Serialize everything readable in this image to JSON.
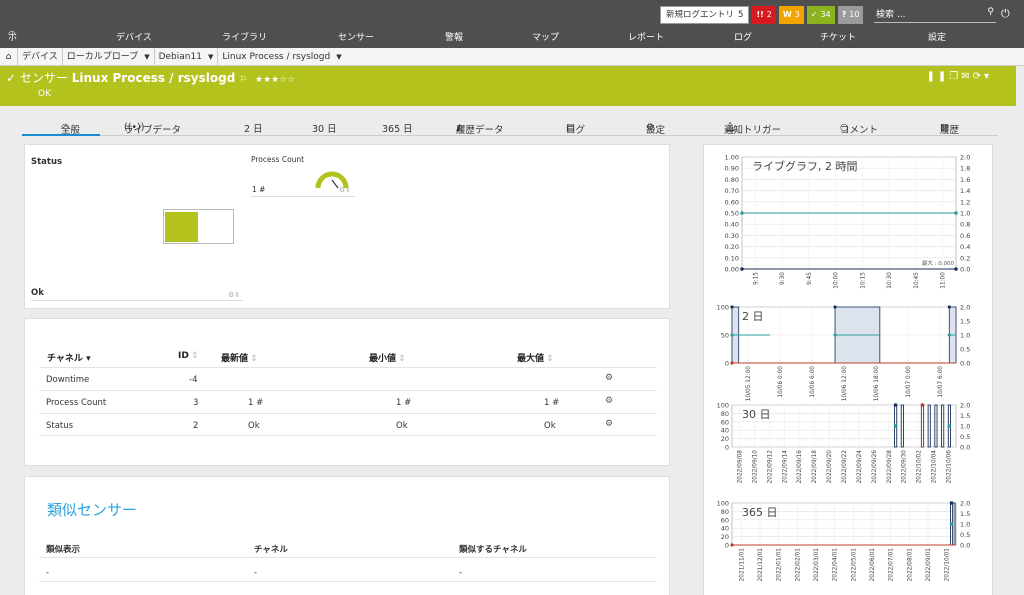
{
  "topbar": {
    "newlog_label": "新規ログエントリ",
    "newlog_count": "5",
    "alarms": [
      {
        "icon": "!!",
        "count": "2",
        "color": "#d71920"
      },
      {
        "icon": "W",
        "count": "3",
        "color": "#f2a500"
      },
      {
        "icon": "✓",
        "count": "34",
        "color": "#8bb31d"
      },
      {
        "icon": "?",
        "count": "10",
        "color": "#9a9a9a"
      }
    ],
    "search_placeholder": "検索 ..."
  },
  "nav": [
    "ホーム",
    "デバイス",
    "ライブラリ",
    "センサー",
    "警報",
    "マップ",
    "レポート",
    "ログ",
    "チケット",
    "設定"
  ],
  "breadcrumb": [
    "デバイス",
    "ローカルプローブ",
    "Debian11",
    "Linux Process / rsyslogd"
  ],
  "header": {
    "prefix": "センサー",
    "name": "Linux Process / rsyslogd",
    "stars": "★★★☆☆",
    "status": "OK",
    "accent": "#b4c21e"
  },
  "tabs": [
    "全般",
    "ライブデータ",
    "2 日",
    "30 日",
    "365 日",
    "履歴データ",
    "ログ",
    "設定",
    "通知トリガー",
    "コメント",
    "履歴"
  ],
  "gauges": {
    "status_label": "Status",
    "status_value": "Ok",
    "process_count_label": "Process Count",
    "process_count_value": "1 #"
  },
  "channels": {
    "headers": [
      "チャネル",
      "ID",
      "最新値",
      "最小値",
      "最大値"
    ],
    "rows": [
      {
        "name": "Downtime",
        "id": "-4",
        "last": "",
        "min": "",
        "max": ""
      },
      {
        "name": "Process Count",
        "id": "3",
        "last": "1 #",
        "min": "1 #",
        "max": "1 #"
      },
      {
        "name": "Status",
        "id": "2",
        "last": "Ok",
        "min": "Ok",
        "max": "Ok"
      }
    ]
  },
  "similar": {
    "title": "類似センサー",
    "headers": [
      "類似表示",
      "チャネル",
      "類似するチャネル"
    ],
    "values": [
      "-",
      "-",
      "-"
    ]
  },
  "chart_data": [
    {
      "type": "line",
      "title": "ライブグラフ, 2 時間",
      "x": [
        "9:15",
        "9:30",
        "9:45",
        "10:00",
        "10:15",
        "10:30",
        "10:45",
        "11:00"
      ],
      "yticks_left": [
        "1.00",
        "0.90",
        "0.80",
        "0.70",
        "0.60",
        "0.50",
        "0.40",
        "0.30",
        "0.20",
        "0.10",
        "0.00"
      ],
      "yticks_right": [
        "2.0",
        "1.8",
        "1.6",
        "1.4",
        "1.2",
        "1.0",
        "0.8",
        "0.6",
        "0.4",
        "0.2",
        "0.0"
      ],
      "ylim": [
        0,
        1
      ],
      "y2lim": [
        0,
        2
      ],
      "annotation": "最大 : 0.000",
      "series": [
        {
          "color": "#2a9d9d",
          "axis": "right",
          "values": [
            1.0,
            1.0,
            1.0,
            1.0,
            1.0,
            1.0,
            1.0,
            1.0
          ]
        },
        {
          "color": "#1a2f5a",
          "axis": "left",
          "values": [
            0,
            0,
            0,
            0,
            0,
            0,
            0,
            0
          ]
        }
      ]
    },
    {
      "type": "area",
      "title": "2 日",
      "x": [
        "10/05 12:00",
        "10/06 0:00",
        "10/06 6:00",
        "10/06 12:00",
        "10/06 18:00",
        "10/07 0:00",
        "10/07 6:00"
      ],
      "yticks_left": [
        "100",
        "50",
        "0"
      ],
      "yticks_right": [
        "2.0",
        "1.5",
        "1.0",
        "0.5",
        "0.0"
      ],
      "ylim": [
        0,
        100
      ],
      "y2lim": [
        0,
        2
      ],
      "series": [
        {
          "color": "#1a2f5a",
          "axis": "left",
          "segments": [
            [
              0.0,
              0.03,
              100
            ],
            [
              0.46,
              0.66,
              100
            ],
            [
              0.97,
              1.0,
              100
            ]
          ]
        },
        {
          "color": "#2a9d9d",
          "axis": "right",
          "segments": [
            [
              0.0,
              0.17,
              1.0
            ],
            [
              0.46,
              0.66,
              1.0
            ],
            [
              0.97,
              1.0,
              1.0
            ]
          ]
        },
        {
          "color": "#c0392b",
          "axis": "left",
          "segments": [
            [
              0.0,
              1.0,
              0
            ]
          ]
        }
      ]
    },
    {
      "type": "bar",
      "title": "30 日",
      "x": [
        "2022/09/08",
        "2022/09/10",
        "2022/09/12",
        "2022/09/14",
        "2022/09/16",
        "2022/09/18",
        "2022/09/20",
        "2022/09/22",
        "2022/09/24",
        "2022/09/26",
        "2022/09/28",
        "2022/09/30",
        "2022/10/02",
        "2022/10/04",
        "2022/10/06"
      ],
      "yticks_left": [
        "100",
        "80",
        "60",
        "40",
        "20",
        "0"
      ],
      "yticks_right": [
        "2.0",
        "1.5",
        "1.0",
        "0.5",
        "0.0"
      ],
      "ylim": [
        0,
        100
      ],
      "y2lim": [
        0,
        2
      ],
      "series": [
        {
          "color": "#1a2f5a",
          "axis": "left",
          "spikes": [
            0.73,
            0.76,
            0.85,
            0.88,
            0.91,
            0.94,
            0.97
          ]
        },
        {
          "color": "#c0392b",
          "axis": "left",
          "spikes": [
            0.85
          ]
        },
        {
          "color": "#2a9d9d",
          "axis": "right",
          "points": [
            [
              0.73,
              1.0
            ],
            [
              0.97,
              1.0
            ]
          ]
        }
      ]
    },
    {
      "type": "bar",
      "title": "365 日",
      "x": [
        "2021/11/01",
        "2021/12/01",
        "2022/01/01",
        "2022/02/01",
        "2022/03/01",
        "2022/04/01",
        "2022/05/01",
        "2022/06/01",
        "2022/07/01",
        "2022/08/01",
        "2022/09/01",
        "2022/10/01"
      ],
      "yticks_left": [
        "100",
        "80",
        "60",
        "40",
        "20",
        "0"
      ],
      "yticks_right": [
        "2.0",
        "1.5",
        "1.0",
        "0.5",
        "0.0"
      ],
      "ylim": [
        0,
        100
      ],
      "y2lim": [
        0,
        2
      ],
      "series": [
        {
          "color": "#1a2f5a",
          "axis": "left",
          "spikes": [
            0.98,
            0.99
          ]
        },
        {
          "color": "#2a9d9d",
          "axis": "right",
          "points": [
            [
              0.98,
              1.0
            ]
          ]
        },
        {
          "color": "#c0392b",
          "axis": "left",
          "segments": [
            [
              0.0,
              1.0,
              0
            ]
          ]
        }
      ]
    }
  ]
}
